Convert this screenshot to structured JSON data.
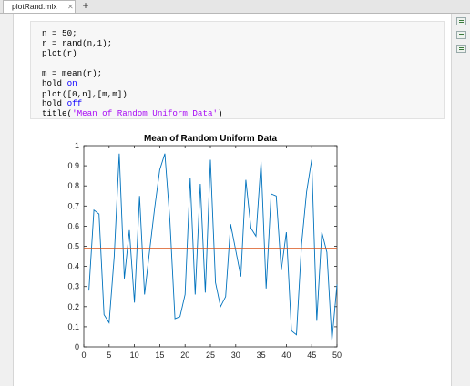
{
  "tab": {
    "label": "plotRand.mlx",
    "close_glyph": "✕",
    "new_tab_glyph": "+"
  },
  "code": {
    "l1": "n = 50;",
    "l2": "r = rand(n,1);",
    "l3": "plot(r)",
    "l4": "m = mean(r);",
    "l5_pre": "hold ",
    "l5_kw": "on",
    "l6": "plot([0,n],[m,m])",
    "l7_pre": "hold ",
    "l7_kw": "off",
    "l8_pre": "title(",
    "l8_str": "'Mean of Random Uniform Data'",
    "l8_post": ")"
  },
  "side_icons": [
    "output-right-icon",
    "output-inline-icon",
    "hide-code-icon"
  ],
  "chart_data": {
    "type": "line",
    "title": "Mean of Random Uniform Data",
    "xlabel": "",
    "ylabel": "",
    "xlim": [
      0,
      50
    ],
    "ylim": [
      0,
      1
    ],
    "xticks": [
      0,
      5,
      10,
      15,
      20,
      25,
      30,
      35,
      40,
      45,
      50
    ],
    "yticks": [
      0,
      0.1,
      0.2,
      0.3,
      0.4,
      0.5,
      0.6,
      0.7,
      0.8,
      0.9,
      1
    ],
    "grid": false,
    "colors": {
      "data": "#0072bd",
      "mean": "#d95319"
    },
    "series": [
      {
        "x": [
          1,
          2,
          3,
          4,
          5,
          6,
          7,
          8,
          9,
          10,
          11,
          12,
          13,
          14,
          15,
          16,
          17,
          18,
          19,
          20,
          21,
          22,
          23,
          24,
          25,
          26,
          27,
          28,
          29,
          30,
          31,
          32,
          33,
          34,
          35,
          36,
          37,
          38,
          39,
          40,
          41,
          42,
          43,
          44,
          45,
          46,
          47,
          48,
          49,
          50
        ],
        "values": [
          0.28,
          0.68,
          0.66,
          0.16,
          0.12,
          0.45,
          0.96,
          0.34,
          0.58,
          0.22,
          0.75,
          0.26,
          0.48,
          0.69,
          0.88,
          0.96,
          0.63,
          0.14,
          0.15,
          0.26,
          0.84,
          0.26,
          0.81,
          0.27,
          0.93,
          0.32,
          0.2,
          0.25,
          0.61,
          0.48,
          0.35,
          0.83,
          0.59,
          0.55,
          0.92,
          0.29,
          0.76,
          0.75,
          0.38,
          0.57,
          0.08,
          0.06,
          0.51,
          0.77,
          0.93,
          0.13,
          0.57,
          0.47,
          0.03,
          0.31
        ]
      },
      {
        "x": [
          0,
          50
        ],
        "values": [
          0.49,
          0.49
        ]
      }
    ]
  }
}
